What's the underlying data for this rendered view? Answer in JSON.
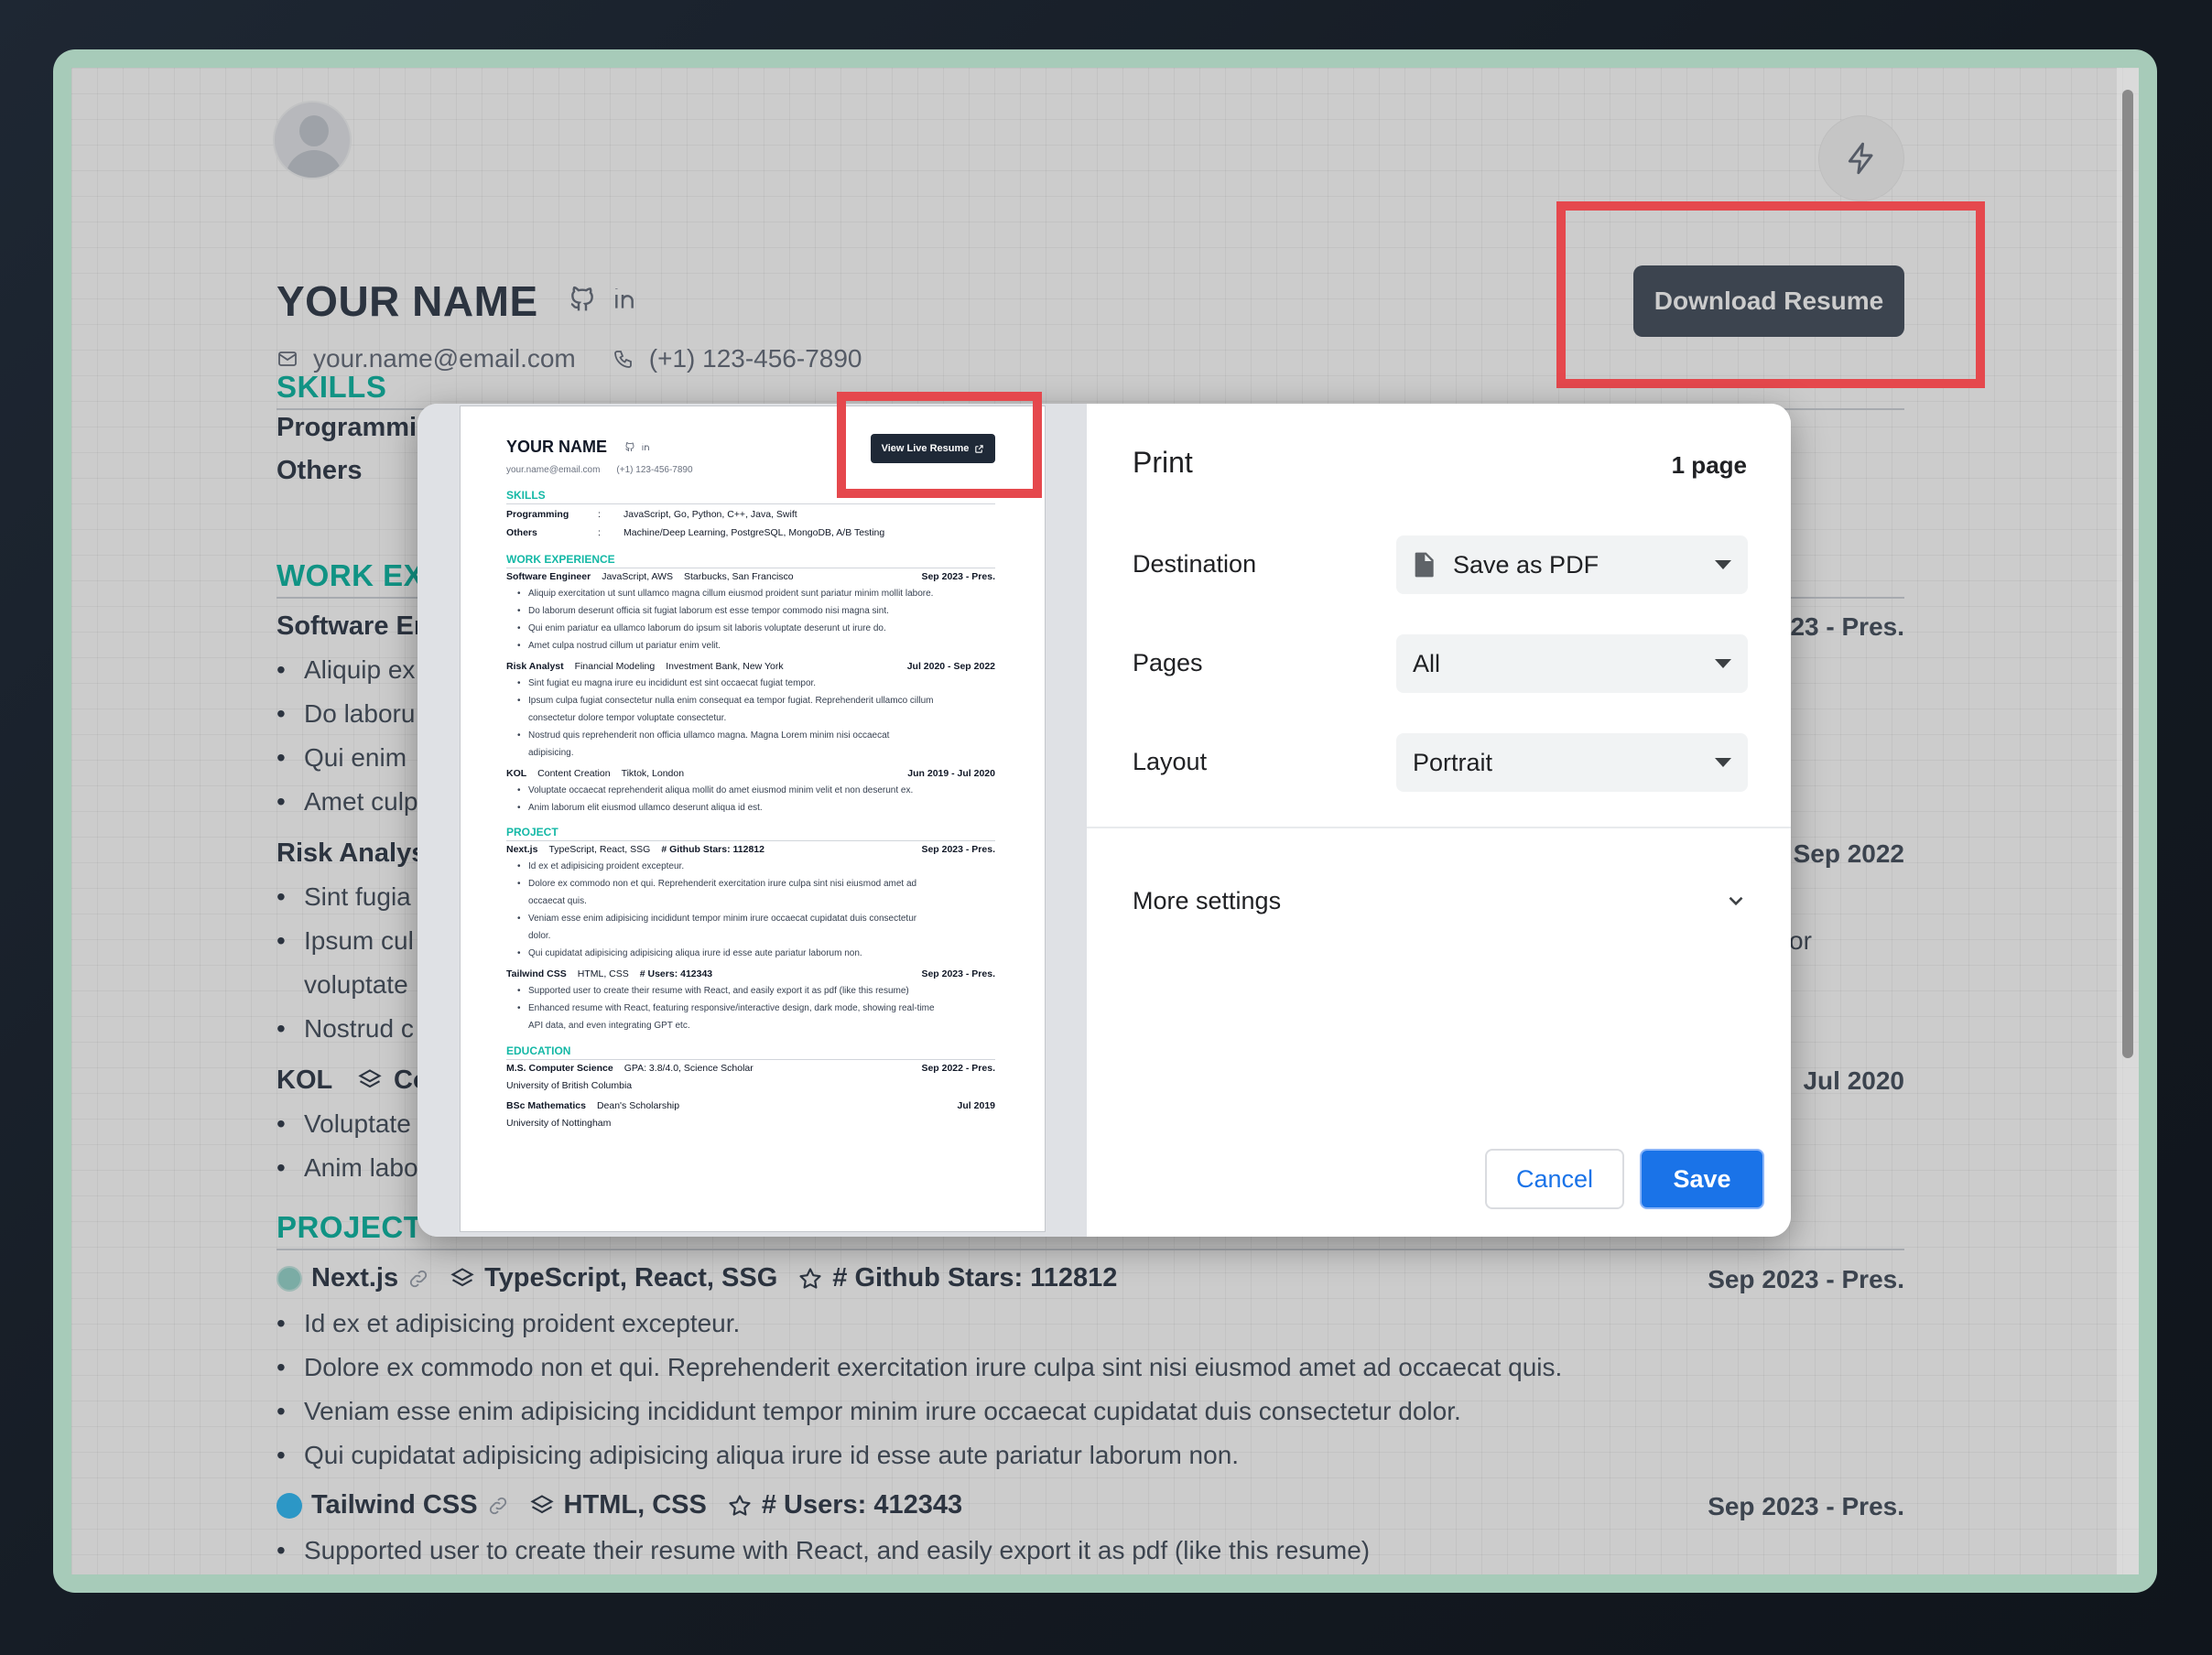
{
  "resume": {
    "name": "YOUR NAME",
    "email": "your.name@email.com",
    "phone": "(+1) 123-456-7890",
    "download_label": "Download Resume",
    "sections": {
      "skills": "SKILLS",
      "work": "WORK EXPERIENCE",
      "work_visible": "WORK EXI",
      "project": "PROJECT",
      "project_visible": "PROJECT",
      "education": "EDUCATION"
    },
    "skills": [
      {
        "label": "Programming",
        "visible": "Programmi",
        "value": "JavaScript, Go, Python, C++, Java, Swift"
      },
      {
        "label": "Others",
        "visible": "Others",
        "value": "Machine/Deep Learning, PostgreSQL, MongoDB, A/B Testing"
      }
    ],
    "jobs": [
      {
        "title": "Software Engineer",
        "visible_title": "Software Er",
        "skill": "JavaScript, AWS",
        "company": "Starbucks, San Francisco",
        "date": "Sep 2023 - Pres.",
        "visible_date": "23 - Pres.",
        "bullets": [
          "Aliquip exercitation ut sunt ullamco magna cillum eiusmod proident sunt pariatur minim mollit labore.",
          "Do laborum deserunt officia sit fugiat laborum est esse tempor commodo nisi magna sint.",
          "Qui enim pariatur ea ullamco laborum do ipsum sit laboris voluptate deserunt ut irure do.",
          "Amet culpa nostrud cillum ut pariatur enim velit."
        ],
        "visible_bullets": [
          "Aliquip ex",
          "Do laboru",
          "Qui enim",
          "Amet culp"
        ]
      },
      {
        "title": "Risk Analyst",
        "visible_title": "Risk Analys",
        "skill": "Financial Modeling",
        "company": "Investment Bank, New York",
        "date": "Jul 2020 - Sep 2022",
        "visible_date": "Sep 2022",
        "bullets": [
          "Sint fugiat eu magna irure eu incididunt est sint occaecat fugiat tempor.",
          "Ipsum culpa fugiat consectetur nulla enim consequat ea tempor fugiat. Reprehenderit ullamco cillum",
          "consectetur dolore tempor voluptate consectetur.",
          "Nostrud quis reprehenderit non officia ullamco magna. Magna Lorem minim nisi occaecat",
          "adipisicing."
        ],
        "visible_bullets": [
          "Sint fugia",
          "Ipsum cul",
          "voluptate",
          "Nostrud c"
        ],
        "visible_tail": "or"
      },
      {
        "title": "KOL",
        "visible_title": "KOL",
        "skill": "Content Creation",
        "visible_skill": "Co",
        "company": "Tiktok, London",
        "date": "Jun 2019 - Jul 2020",
        "visible_date": "Jul 2020",
        "bullets": [
          "Voluptate occaecat reprehenderit aliqua mollit do amet eiusmod minim velit et non deserunt ex.",
          "Anim laborum elit eiusmod ullamco deserunt aliqua id est."
        ],
        "visible_bullets": [
          "Voluptate",
          "Anim labo"
        ]
      }
    ],
    "projects": [
      {
        "name": "Next.js",
        "tech": "TypeScript, React, SSG",
        "stat": "# Github Stars: 112812",
        "date": "Sep 2023 - Pres.",
        "bullets": [
          "Id ex et adipisicing proident excepteur.",
          "Dolore ex commodo non et qui. Reprehenderit exercitation irure culpa sint nisi eiusmod amet ad",
          "occaecat quis.",
          "Veniam esse enim adipisicing incididunt tempor minim irure occaecat cupidatat duis consectetur",
          "dolor.",
          "Qui cupidatat adipisicing adipisicing aliqua irure id esse aute pariatur laborum non."
        ],
        "bg_bullets": [
          "Id ex et adipisicing proident excepteur.",
          "Dolore ex commodo non et qui. Reprehenderit exercitation irure culpa sint nisi eiusmod amet ad occaecat quis.",
          "Veniam esse enim adipisicing incididunt tempor minim irure occaecat cupidatat duis consectetur dolor.",
          "Qui cupidatat adipisicing adipisicing aliqua irure id esse aute pariatur laborum non."
        ]
      },
      {
        "name": "Tailwind CSS",
        "tech": "HTML, CSS",
        "stat": "# Users: 412343",
        "date": "Sep 2023 - Pres.",
        "bullets": [
          "Supported user to create their resume with React, and easily export it as pdf (like this resume)",
          "Enhanced resume with React, featuring responsive/interactive design, dark mode, showing real-time",
          "API data, and even integrating GPT etc."
        ],
        "bg_bullets": [
          "Supported user to create their resume with React, and easily export it as pdf (like this resume)"
        ]
      }
    ],
    "education": [
      {
        "degree": "M.S. Computer Science",
        "detail": "GPA: 3.8/4.0, Science Scholar",
        "date": "Sep 2022 - Pres.",
        "school": "University of British Columbia"
      },
      {
        "degree": "BSc Mathematics",
        "detail": "Dean's Scholarship",
        "date": "Jul 2019",
        "school": "University of Nottingham"
      }
    ],
    "view_live_label": "View Live Resume"
  },
  "print_dialog": {
    "title": "Print",
    "page_count": "1 page",
    "destination_label": "Destination",
    "destination_value": "Save as PDF",
    "pages_label": "Pages",
    "pages_value": "All",
    "layout_label": "Layout",
    "layout_value": "Portrait",
    "more_settings": "More settings",
    "cancel": "Cancel",
    "save": "Save"
  },
  "colors": {
    "accent_teal": "#14b8a6",
    "highlight_red": "#e5484d",
    "print_blue": "#1a73e8",
    "window_frame": "#a7cbb9"
  },
  "icons": [
    "user-avatar",
    "bolt-icon",
    "github-icon",
    "linkedin-icon",
    "mail-icon",
    "phone-icon",
    "layers-icon",
    "star-icon",
    "link-icon",
    "document-icon",
    "chevron-down-icon",
    "external-link-icon",
    "award-icon"
  ]
}
